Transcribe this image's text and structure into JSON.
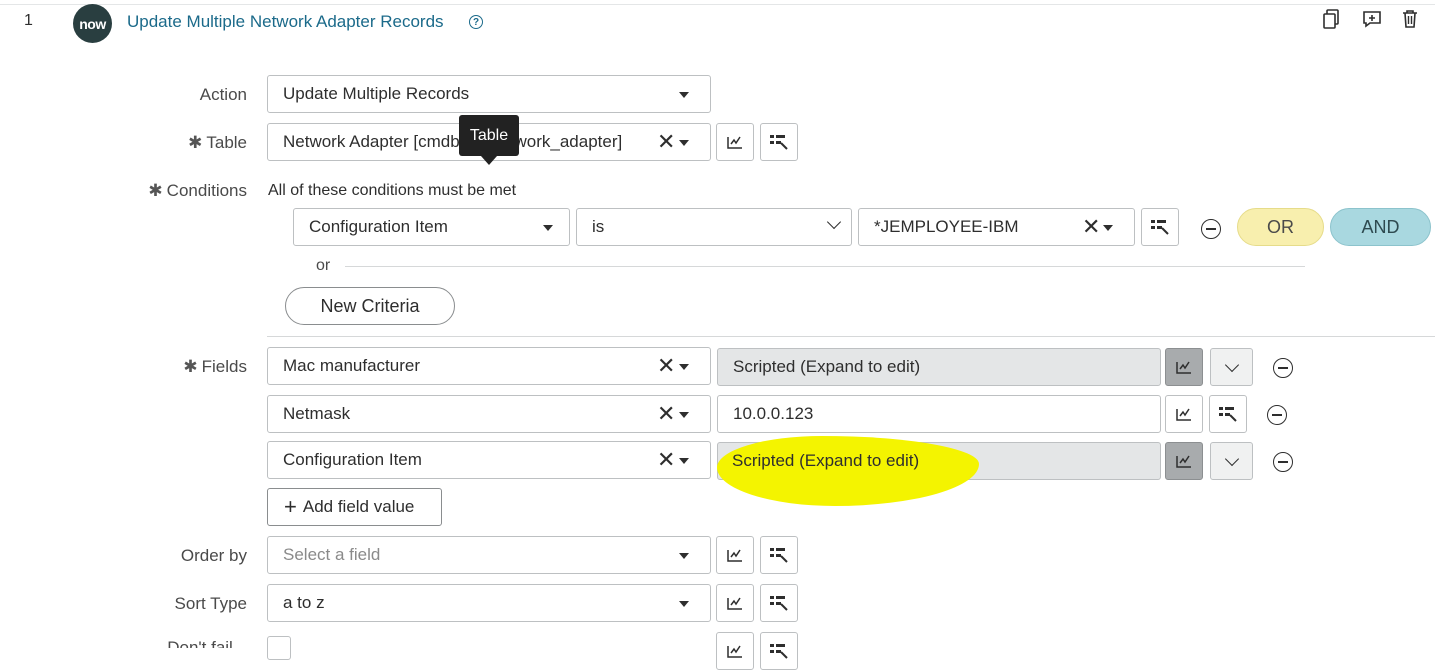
{
  "step": {
    "number": "1",
    "logo_text": "now",
    "title": "Update Multiple Network Adapter Records",
    "help_icon": "?"
  },
  "header_icons": [
    "copy-icon",
    "add-comment-icon",
    "delete-icon"
  ],
  "form": {
    "action": {
      "label": "Action",
      "value": "Update Multiple Records"
    },
    "table": {
      "label": "Table",
      "value": "Network Adapter [cmdb_ci_network_adapter]",
      "tooltip": "Table"
    },
    "conditions": {
      "label": "Conditions",
      "summary": "All of these conditions must be met",
      "field": "Configuration Item",
      "operator": "is",
      "value": "*JEMPLOYEE-IBM",
      "or_button": "OR",
      "and_button": "AND",
      "or_separator": "or",
      "new_criteria": "New Criteria"
    },
    "fields": {
      "label": "Fields",
      "rows": [
        {
          "name": "Mac manufacturer",
          "value": "Scripted (Expand to edit)"
        },
        {
          "name": "Netmask",
          "value": "10.0.0.123"
        },
        {
          "name": "Configuration Item",
          "value": "Scripted (Expand to edit)"
        }
      ],
      "add_button": "Add field value"
    },
    "order_by": {
      "label": "Order by",
      "placeholder": "Select a field"
    },
    "sort_type": {
      "label": "Sort Type",
      "value": "a to z"
    },
    "dont_fail": {
      "label": "Don't fail..."
    }
  },
  "colors": {
    "link": "#1b6a8a",
    "or_pill": "#f8efae",
    "and_pill": "#a9d8e0",
    "highlight": "#f4f400"
  }
}
